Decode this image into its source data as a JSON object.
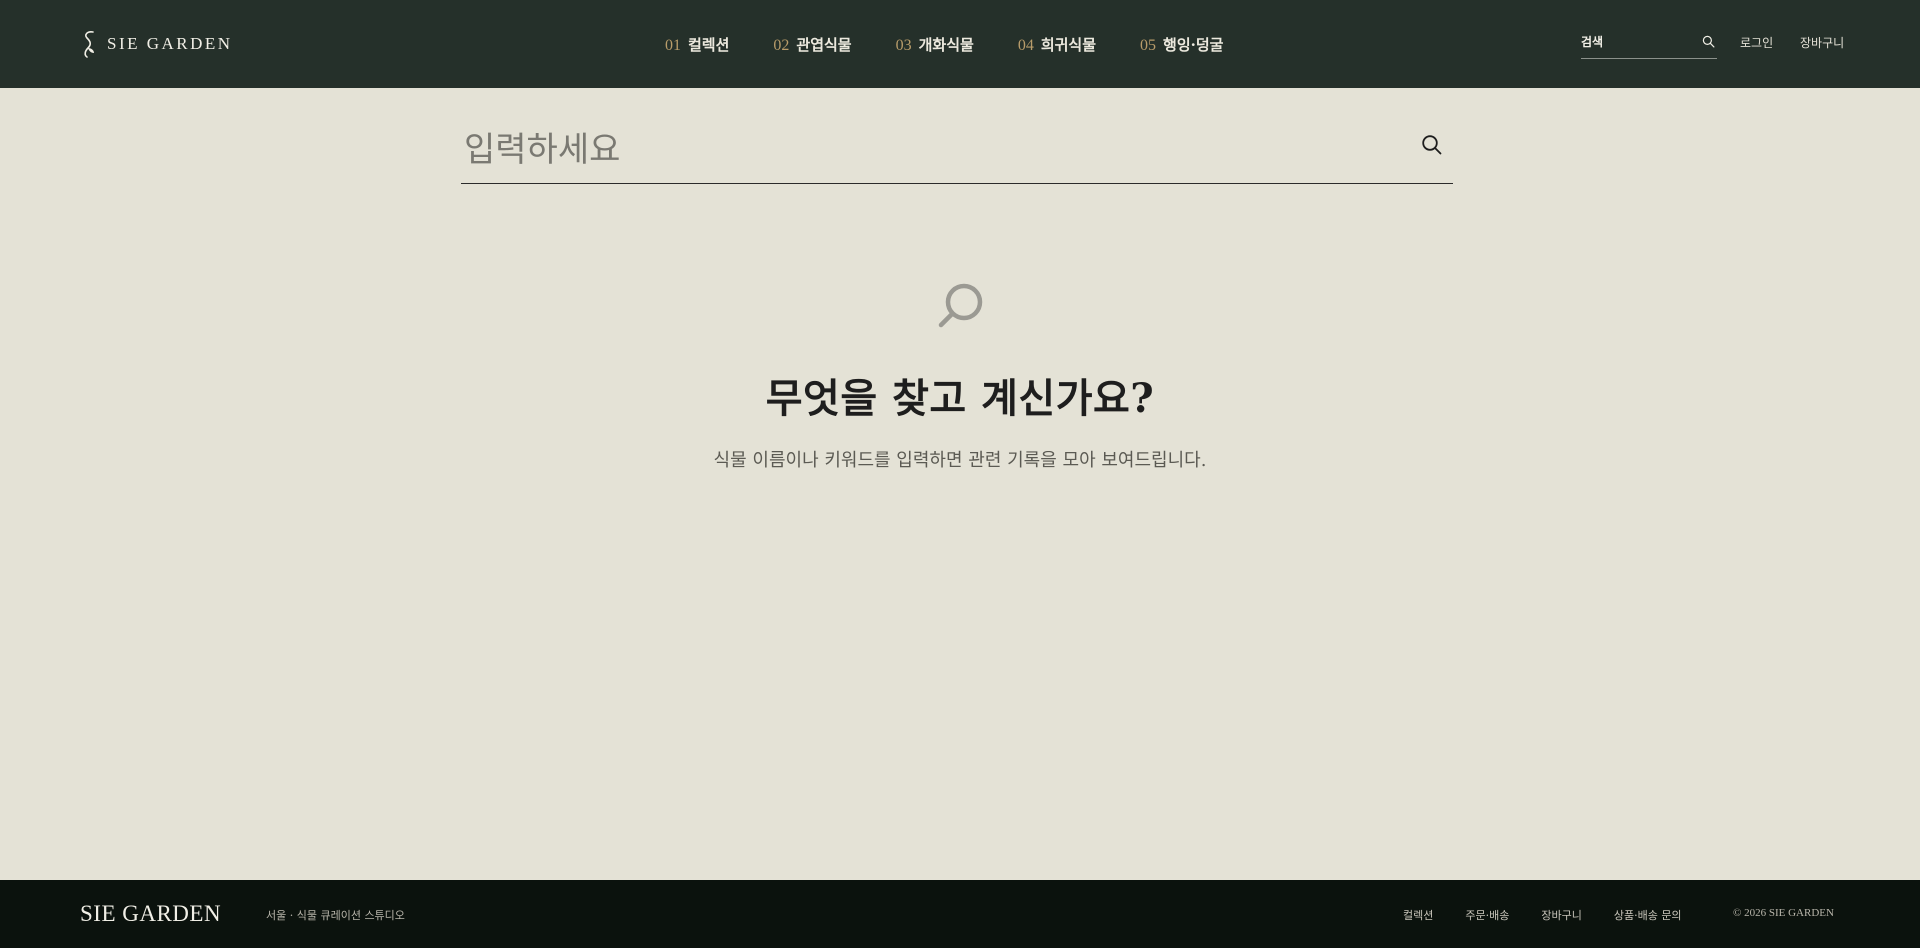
{
  "header": {
    "logo_text": "SIE GARDEN",
    "nav": [
      {
        "num": "01",
        "label": "컬렉션"
      },
      {
        "num": "02",
        "label": "관엽식물"
      },
      {
        "num": "03",
        "label": "개화식물"
      },
      {
        "num": "04",
        "label": "희귀식물"
      },
      {
        "num": "05",
        "label": "행잉·덩굴"
      }
    ],
    "search_label": "검색",
    "login": "로그인",
    "cart": "장바구니"
  },
  "search": {
    "placeholder": "입력하세요",
    "value": ""
  },
  "empty_state": {
    "title": "무엇을 찾고 계신가요?",
    "description": "식물 이름이나 키워드를 입력하면 관련 기록을 모아 보여드립니다."
  },
  "footer": {
    "logo_text": "SIE GARDEN",
    "tagline": "서울 · 식물 큐레이션 스튜디오",
    "links": [
      "컬렉션",
      "주문·배송",
      "장바구니",
      "상품·배송 문의"
    ],
    "copyright": "© 2026 SIE GARDEN"
  },
  "colors": {
    "header_bg": "#25302a",
    "page_bg": "#e4e2d6",
    "footer_bg": "#0b120d",
    "accent": "#b89c6a"
  },
  "icons": [
    "logo-leaf-icon",
    "search-icon",
    "magnifier-empty-icon"
  ]
}
